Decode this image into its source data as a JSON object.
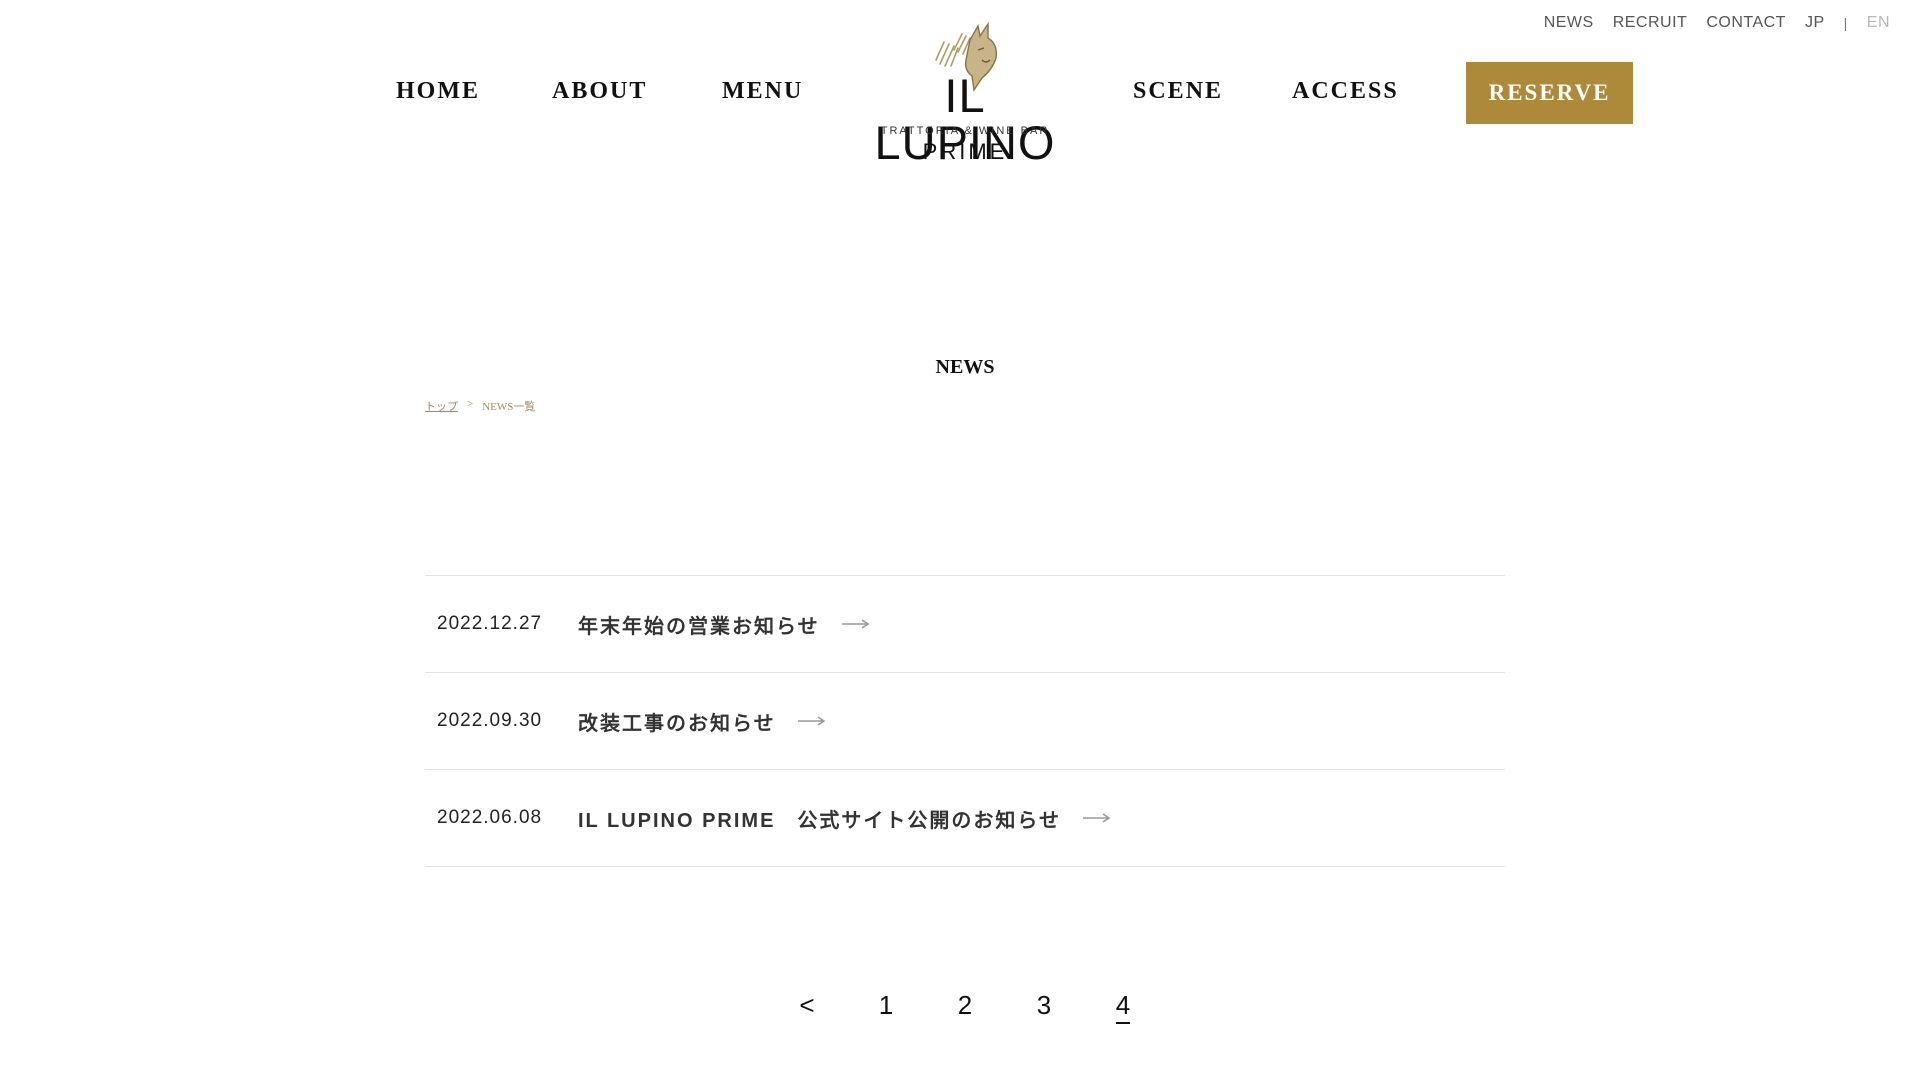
{
  "utility_nav": {
    "items": [
      "NEWS",
      "RECRUIT",
      "CONTACT"
    ],
    "lang_jp": "JP",
    "lang_sep": "|",
    "lang_en": "EN"
  },
  "main_nav": {
    "home": "HOME",
    "about": "ABOUT",
    "menu": "MENU",
    "scene": "SCENE",
    "access": "ACCESS",
    "reserve": "RESERVE"
  },
  "logo": {
    "name": "IL LUPINO",
    "subtitle": "TRATTORIA & WINE BAR",
    "prime": "PRIME"
  },
  "page": {
    "title": "NEWS"
  },
  "breadcrumb": {
    "top": "トップ",
    "separator": ">",
    "current": "NEWS一覧"
  },
  "news": [
    {
      "date": "2022.12.27",
      "title": "年末年始の営業お知らせ"
    },
    {
      "date": "2022.09.30",
      "title": "改装工事のお知らせ"
    },
    {
      "date": "2022.06.08",
      "title": "IL LUPINO PRIME　公式サイト公開のお知らせ"
    }
  ],
  "pagination": {
    "prev": "<",
    "pages": [
      "1",
      "2",
      "3",
      "4"
    ],
    "current": "4"
  },
  "colors": {
    "accent": "#ad8a3a",
    "text": "#111111",
    "divider": "#e3e3e3",
    "breadcrumb": "#a08a5a"
  }
}
